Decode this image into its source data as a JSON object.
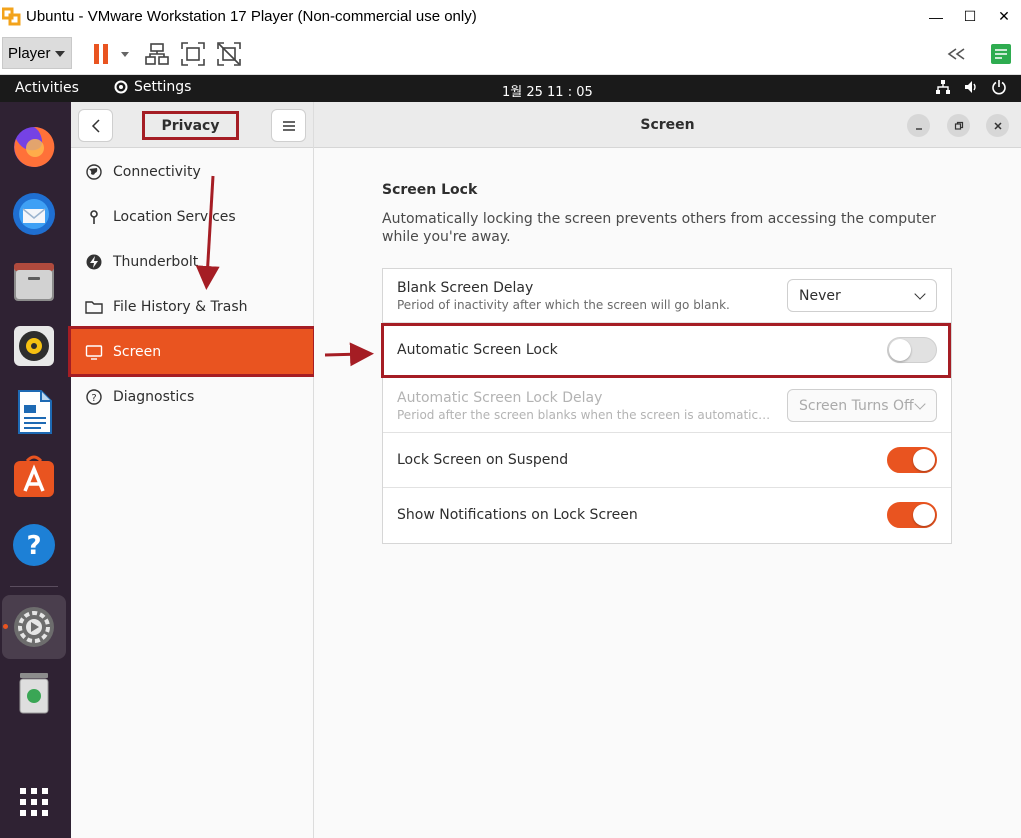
{
  "vmware": {
    "title": "Ubuntu - VMware Workstation 17 Player (Non-commercial use only)",
    "player_label": "Player",
    "window_controls": [
      "—",
      "☐",
      "✕"
    ]
  },
  "topbar": {
    "activities": "Activities",
    "app_name": "Settings",
    "clock": "1월 25  11 : 05"
  },
  "dock": {
    "items": [
      "firefox-icon",
      "thunderbird-icon",
      "files-icon",
      "rhythmbox-icon",
      "libreoffice-writer-icon",
      "app-center-icon",
      "help-icon",
      "settings-icon",
      "trash-icon",
      "show-apps-icon"
    ]
  },
  "sidebar": {
    "title": "Privacy",
    "items": [
      {
        "label": "Connectivity",
        "icon": "globe-icon"
      },
      {
        "label": "Location Services",
        "icon": "location-pin-icon"
      },
      {
        "label": "Thunderbolt",
        "icon": "thunderbolt-icon"
      },
      {
        "label": "File History & Trash",
        "icon": "folder-icon"
      },
      {
        "label": "Screen",
        "icon": "monitor-icon",
        "active": true
      },
      {
        "label": "Diagnostics",
        "icon": "question-icon"
      }
    ]
  },
  "main": {
    "title": "Screen",
    "section_title": "Screen Lock",
    "section_desc": "Automatically locking the screen prevents others from accessing the computer while you're away.",
    "rows": [
      {
        "label": "Blank Screen Delay",
        "sub": "Period of inactivity after which the screen will go blank.",
        "control": "dropdown",
        "value": "Never"
      },
      {
        "label": "Automatic Screen Lock",
        "control": "toggle",
        "on": false
      },
      {
        "label": "Automatic Screen Lock Delay",
        "sub": "Period after the screen blanks when the screen is automatically lo...",
        "control": "dropdown",
        "value": "Screen Turns Off",
        "disabled": true
      },
      {
        "label": "Lock Screen on Suspend",
        "control": "toggle",
        "on": true
      },
      {
        "label": "Show Notifications on Lock Screen",
        "control": "toggle",
        "on": true
      }
    ]
  },
  "colors": {
    "accent": "#e95420",
    "annotation": "#a51d24",
    "dock_bg": "#2f2233"
  }
}
